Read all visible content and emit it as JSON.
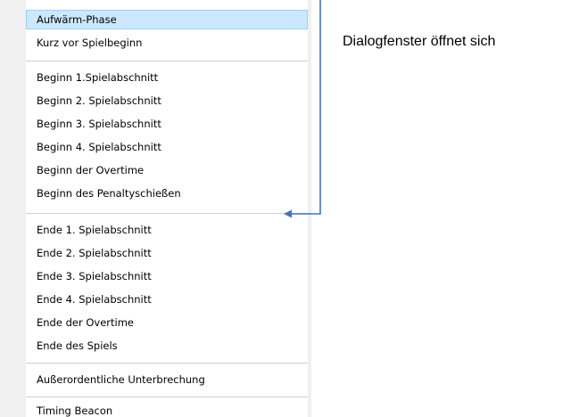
{
  "menu": {
    "items": [
      {
        "label": "Aufwärm-Phase",
        "highlighted": true
      },
      {
        "label": "Kurz vor Spielbeginn"
      },
      {
        "label": "Beginn 1.Spielabschnitt"
      },
      {
        "label": "Beginn 2. Spielabschnitt"
      },
      {
        "label": "Beginn 3. Spielabschnitt"
      },
      {
        "label": "Beginn 4. Spielabschnitt"
      },
      {
        "label": "Beginn der Overtime"
      },
      {
        "label": "Beginn des Penaltyschießen"
      },
      {
        "label": "Ende 1. Spielabschnitt"
      },
      {
        "label": "Ende 2. Spielabschnitt"
      },
      {
        "label": "Ende 3. Spielabschnitt"
      },
      {
        "label": "Ende 4. Spielabschnitt"
      },
      {
        "label": "Ende der Overtime"
      },
      {
        "label": "Ende des Spiels"
      },
      {
        "label": "Außerordentliche Unterbrechung"
      },
      {
        "label": "Timing Beacon"
      }
    ]
  },
  "annotation": {
    "text": "Dialogfenster öffnet sich"
  },
  "colors": {
    "highlight": "#cce8ff",
    "highlight_border": "#99d1ff",
    "arrow": "#4472c4"
  }
}
